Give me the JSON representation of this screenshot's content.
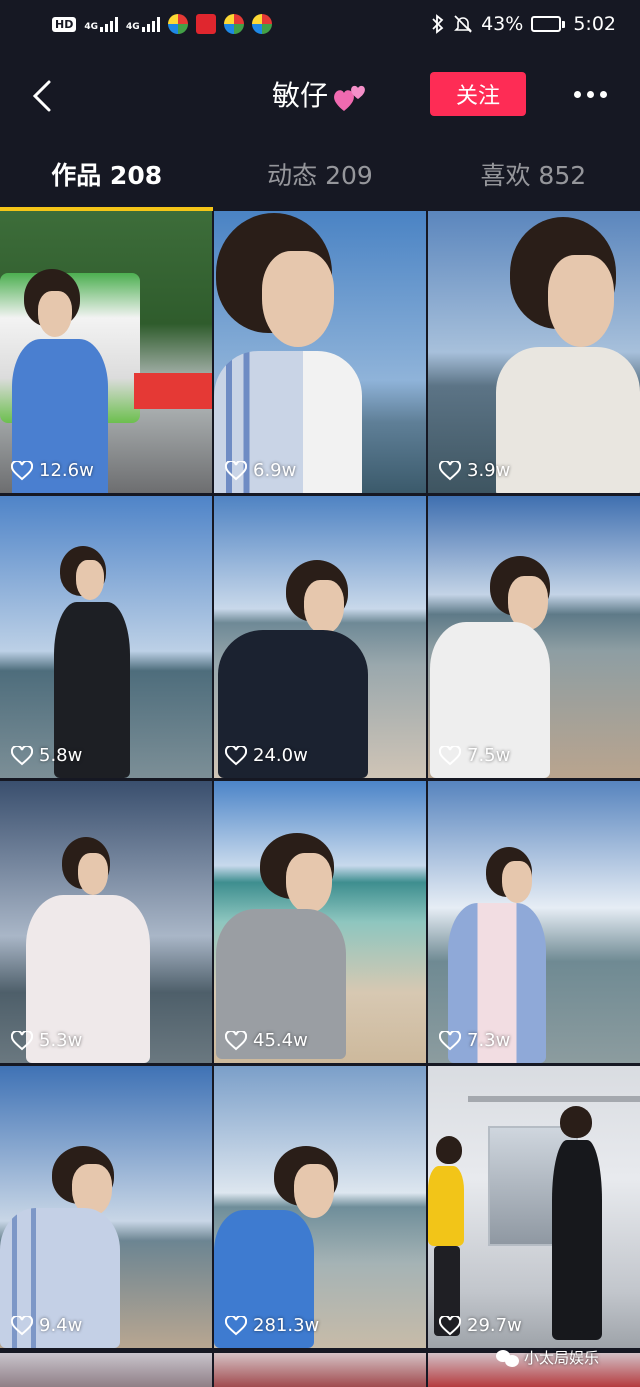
{
  "status_bar": {
    "network_badge": "HD",
    "network_label_1": "4G",
    "network_label_2": "4G",
    "battery_percent": "43%",
    "battery_level": 0.43,
    "time": "5:02"
  },
  "header": {
    "title": "敏仔",
    "follow_label": "关注"
  },
  "tabs": [
    {
      "label": "作品 208",
      "active": true
    },
    {
      "label": "动态 209",
      "active": false
    },
    {
      "label": "喜欢 852",
      "active": false
    }
  ],
  "videos": [
    {
      "likes": "12.6w"
    },
    {
      "likes": "6.9w"
    },
    {
      "likes": "3.9w"
    },
    {
      "likes": "5.8w"
    },
    {
      "likes": "24.0w"
    },
    {
      "likes": "7.5w"
    },
    {
      "likes": "5.3w"
    },
    {
      "likes": "45.4w"
    },
    {
      "likes": "7.3w"
    },
    {
      "likes": "9.4w"
    },
    {
      "likes": "281.3w"
    },
    {
      "likes": "29.7w"
    }
  ],
  "watermark": "小太局娱乐",
  "colors": {
    "background": "#161823",
    "follow_button": "#fe2c55",
    "tab_indicator": "#f5c518"
  }
}
